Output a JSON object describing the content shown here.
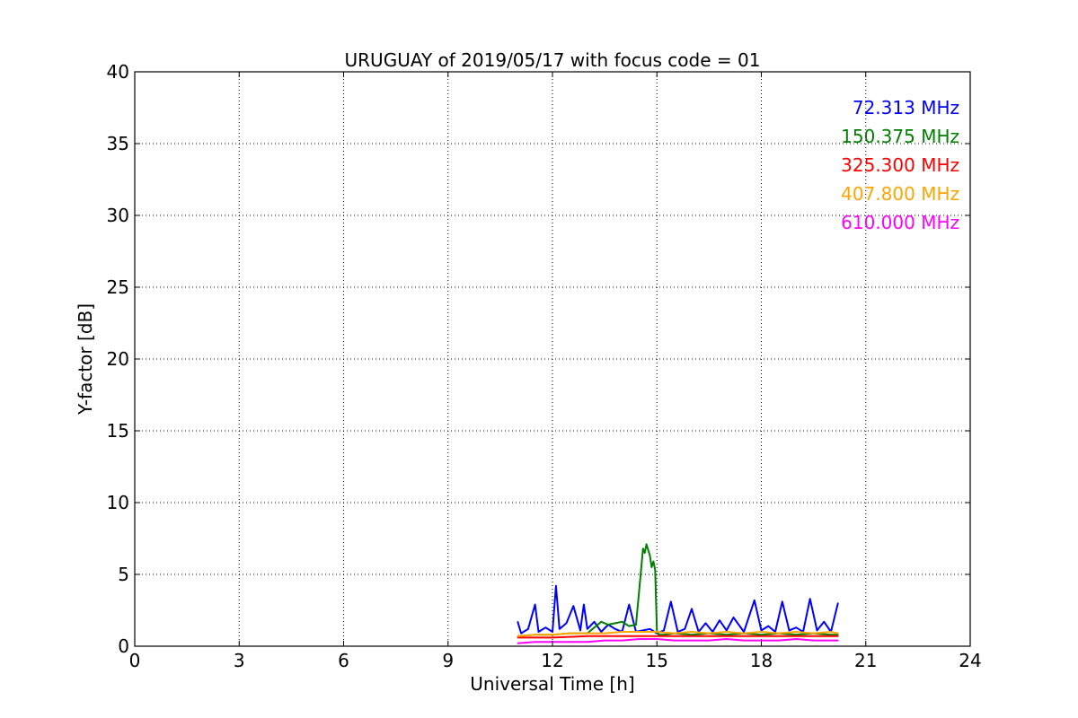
{
  "chart_data": {
    "type": "line",
    "title": "URUGUAY of 2019/05/17 with focus code = 01",
    "xlabel": "Universal Time [h]",
    "ylabel": "Y-factor [dB]",
    "xlim": [
      0,
      24
    ],
    "ylim": [
      0,
      40
    ],
    "xticks": [
      "0",
      "3",
      "6",
      "9",
      "12",
      "15",
      "18",
      "21",
      "24"
    ],
    "yticks": [
      "0",
      "5",
      "10",
      "15",
      "20",
      "25",
      "30",
      "35",
      "40"
    ],
    "grid": true,
    "legend_placement": "top-right",
    "series": [
      {
        "name": "72.313 MHz",
        "color": "#0000ff",
        "x": [
          11.0,
          11.1,
          11.3,
          11.5,
          11.6,
          11.8,
          12.0,
          12.1,
          12.2,
          12.4,
          12.6,
          12.8,
          12.9,
          13.0,
          13.2,
          13.4,
          13.6,
          13.8,
          14.0,
          14.2,
          14.4,
          14.6,
          14.8,
          15.0,
          15.2,
          15.4,
          15.6,
          15.8,
          16.0,
          16.2,
          16.4,
          16.6,
          16.8,
          17.0,
          17.2,
          17.5,
          17.8,
          18.0,
          18.2,
          18.4,
          18.6,
          18.8,
          19.0,
          19.2,
          19.4,
          19.6,
          19.8,
          20.0,
          20.2
        ],
        "y": [
          1.7,
          0.9,
          1.2,
          2.9,
          1.0,
          1.3,
          1.0,
          4.2,
          1.2,
          1.6,
          2.8,
          1.1,
          2.9,
          1.2,
          1.7,
          1.0,
          1.5,
          1.2,
          1.0,
          2.9,
          1.0,
          1.1,
          1.2,
          0.9,
          1.1,
          3.1,
          1.0,
          1.2,
          2.6,
          1.0,
          1.6,
          1.0,
          1.8,
          1.1,
          2.0,
          1.0,
          3.2,
          1.1,
          1.4,
          1.0,
          3.1,
          1.1,
          1.3,
          1.0,
          3.3,
          1.1,
          1.7,
          1.0,
          3.0
        ]
      },
      {
        "name": "150.375 MHz",
        "color": "#008000",
        "x": [
          11.0,
          11.5,
          12.0,
          12.5,
          13.0,
          13.4,
          13.6,
          13.8,
          14.0,
          14.2,
          14.4,
          14.6,
          14.65,
          14.7,
          14.8,
          14.85,
          14.9,
          14.95,
          15.0,
          15.05,
          15.2,
          15.5,
          16.0,
          16.5,
          17.0,
          17.5,
          18.0,
          18.5,
          19.0,
          19.5,
          20.0,
          20.2
        ],
        "y": [
          0.7,
          0.8,
          0.8,
          0.9,
          0.9,
          1.7,
          1.5,
          1.6,
          1.7,
          1.4,
          1.5,
          6.8,
          6.5,
          7.1,
          6.3,
          5.5,
          5.9,
          5.3,
          1.0,
          0.8,
          0.8,
          0.9,
          0.8,
          0.9,
          0.8,
          0.9,
          0.8,
          0.9,
          0.8,
          0.9,
          0.8,
          0.8
        ]
      },
      {
        "name": "325.300 MHz",
        "color": "#ff0000",
        "x": [
          11.0,
          12.0,
          13.0,
          14.0,
          15.0,
          16.0,
          17.0,
          18.0,
          19.0,
          20.0,
          20.2
        ],
        "y": [
          0.6,
          0.6,
          0.7,
          0.7,
          0.7,
          0.7,
          0.7,
          0.7,
          0.7,
          0.7,
          0.7
        ]
      },
      {
        "name": "407.800 MHz",
        "color": "#ffa500",
        "x": [
          11.0,
          11.5,
          12.0,
          12.5,
          13.0,
          13.5,
          14.0,
          14.5,
          15.0,
          15.5,
          16.0,
          16.5,
          17.0,
          17.5,
          18.0,
          18.5,
          19.0,
          19.5,
          20.0,
          20.2
        ],
        "y": [
          0.7,
          0.8,
          0.8,
          0.9,
          0.9,
          0.9,
          1.0,
          1.0,
          1.0,
          0.9,
          1.0,
          0.9,
          1.0,
          0.9,
          1.0,
          0.9,
          1.0,
          0.9,
          1.0,
          0.9
        ]
      },
      {
        "name": "610.000 MHz",
        "color": "#ff00ff",
        "x": [
          11.0,
          11.5,
          12.0,
          12.5,
          13.0,
          13.5,
          14.0,
          14.5,
          15.0,
          15.5,
          16.0,
          16.5,
          17.0,
          17.5,
          18.0,
          18.5,
          19.0,
          19.5,
          20.0,
          20.2
        ],
        "y": [
          0.2,
          0.3,
          0.3,
          0.3,
          0.3,
          0.4,
          0.4,
          0.5,
          0.5,
          0.4,
          0.4,
          0.4,
          0.5,
          0.4,
          0.4,
          0.4,
          0.5,
          0.4,
          0.4,
          0.4
        ]
      }
    ]
  }
}
